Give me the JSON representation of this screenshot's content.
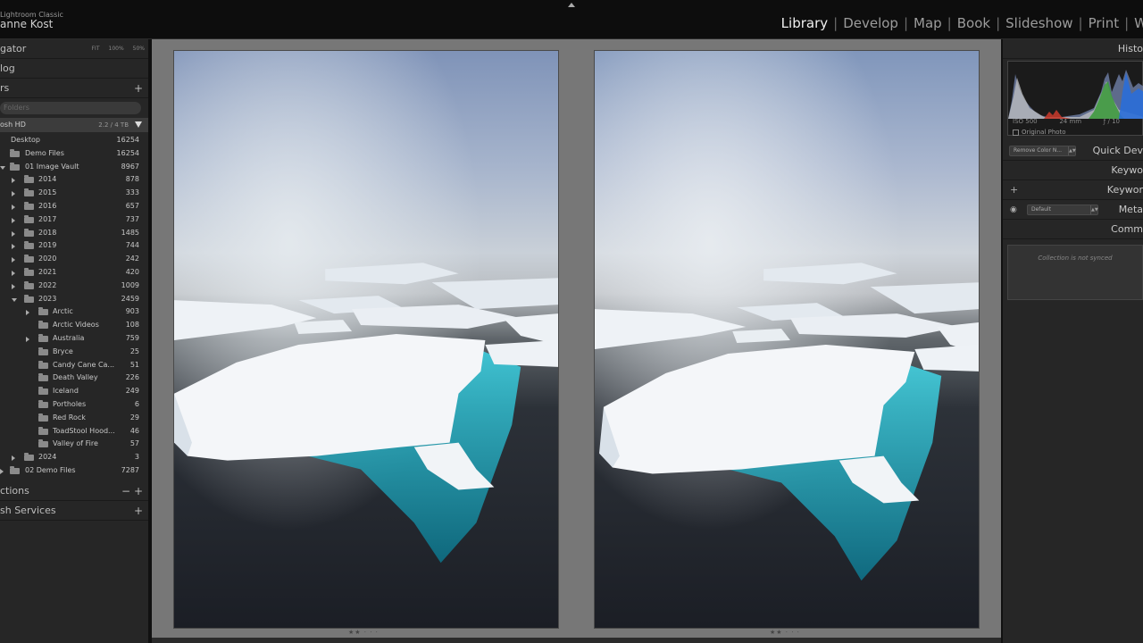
{
  "app": {
    "brand_line1": "Lightroom Classic",
    "brand_line2": "anne Kost"
  },
  "modules": [
    {
      "label": "Library",
      "active": true
    },
    {
      "label": "Develop",
      "active": false
    },
    {
      "label": "Map",
      "active": false
    },
    {
      "label": "Book",
      "active": false
    },
    {
      "label": "Slideshow",
      "active": false
    },
    {
      "label": "Print",
      "active": false
    },
    {
      "label": "W",
      "active": false
    }
  ],
  "left_panel": {
    "navigator_label": "gator",
    "nav_options": [
      "FIT",
      "100%",
      "50%"
    ],
    "catalog_label": "log",
    "folders_label": "rs",
    "collections_label": "ctions",
    "publish_label": "sh Services",
    "folder_search_placeholder": "Folders",
    "volume": {
      "name": "osh HD",
      "size": "2.2 / 4 TB"
    },
    "folders": [
      {
        "name": "Desktop",
        "count": "16254",
        "level": 0,
        "expand": "none"
      },
      {
        "name": "Demo Files",
        "count": "16254",
        "level": 1,
        "expand": "none"
      },
      {
        "name": "01 Image Vault",
        "count": "8967",
        "level": 1,
        "expand": "open"
      },
      {
        "name": "2014",
        "count": "878",
        "level": 2,
        "expand": "closed"
      },
      {
        "name": "2015",
        "count": "333",
        "level": 2,
        "expand": "closed"
      },
      {
        "name": "2016",
        "count": "657",
        "level": 2,
        "expand": "closed"
      },
      {
        "name": "2017",
        "count": "737",
        "level": 2,
        "expand": "closed"
      },
      {
        "name": "2018",
        "count": "1485",
        "level": 2,
        "expand": "closed"
      },
      {
        "name": "2019",
        "count": "744",
        "level": 2,
        "expand": "closed"
      },
      {
        "name": "2020",
        "count": "242",
        "level": 2,
        "expand": "closed"
      },
      {
        "name": "2021",
        "count": "420",
        "level": 2,
        "expand": "closed"
      },
      {
        "name": "2022",
        "count": "1009",
        "level": 2,
        "expand": "closed"
      },
      {
        "name": "2023",
        "count": "2459",
        "level": 2,
        "expand": "open"
      },
      {
        "name": "Arctic",
        "count": "903",
        "level": 3,
        "expand": "closed"
      },
      {
        "name": "Arctic Videos",
        "count": "108",
        "level": 3,
        "expand": "none"
      },
      {
        "name": "Australia",
        "count": "759",
        "level": 3,
        "expand": "closed"
      },
      {
        "name": "Bryce",
        "count": "25",
        "level": 3,
        "expand": "none"
      },
      {
        "name": "Candy Cane Ca...",
        "count": "51",
        "level": 3,
        "expand": "none"
      },
      {
        "name": "Death Valley",
        "count": "226",
        "level": 3,
        "expand": "none"
      },
      {
        "name": "Iceland",
        "count": "249",
        "level": 3,
        "expand": "none"
      },
      {
        "name": "Portholes",
        "count": "6",
        "level": 3,
        "expand": "none"
      },
      {
        "name": "Red Rock",
        "count": "29",
        "level": 3,
        "expand": "none"
      },
      {
        "name": "ToadStool Hood...",
        "count": "46",
        "level": 3,
        "expand": "none"
      },
      {
        "name": "Valley of Fire",
        "count": "57",
        "level": 3,
        "expand": "none"
      },
      {
        "name": "2024",
        "count": "3",
        "level": 2,
        "expand": "closed"
      },
      {
        "name": "02 Demo Files",
        "count": "7287",
        "level": 1,
        "expand": "closed"
      }
    ]
  },
  "center": {
    "rating_left": "★★ · · ·",
    "rating_right": "★★ · · ·"
  },
  "right_panel": {
    "histogram_label": "Histo",
    "hist_info": [
      "ISO 500",
      "24 mm",
      "ƒ / 10"
    ],
    "original_photo": "Original Photo",
    "quick_develop_label": "Quick Dev",
    "saved_preset": "Remove Color N...",
    "keywording_label": "Keywo",
    "keyword_list_label": "Keywor",
    "metadata_label": "Meta",
    "metadata_preset": "Default",
    "comments_label": "Comm",
    "comments_text": "Collection is not synced"
  }
}
